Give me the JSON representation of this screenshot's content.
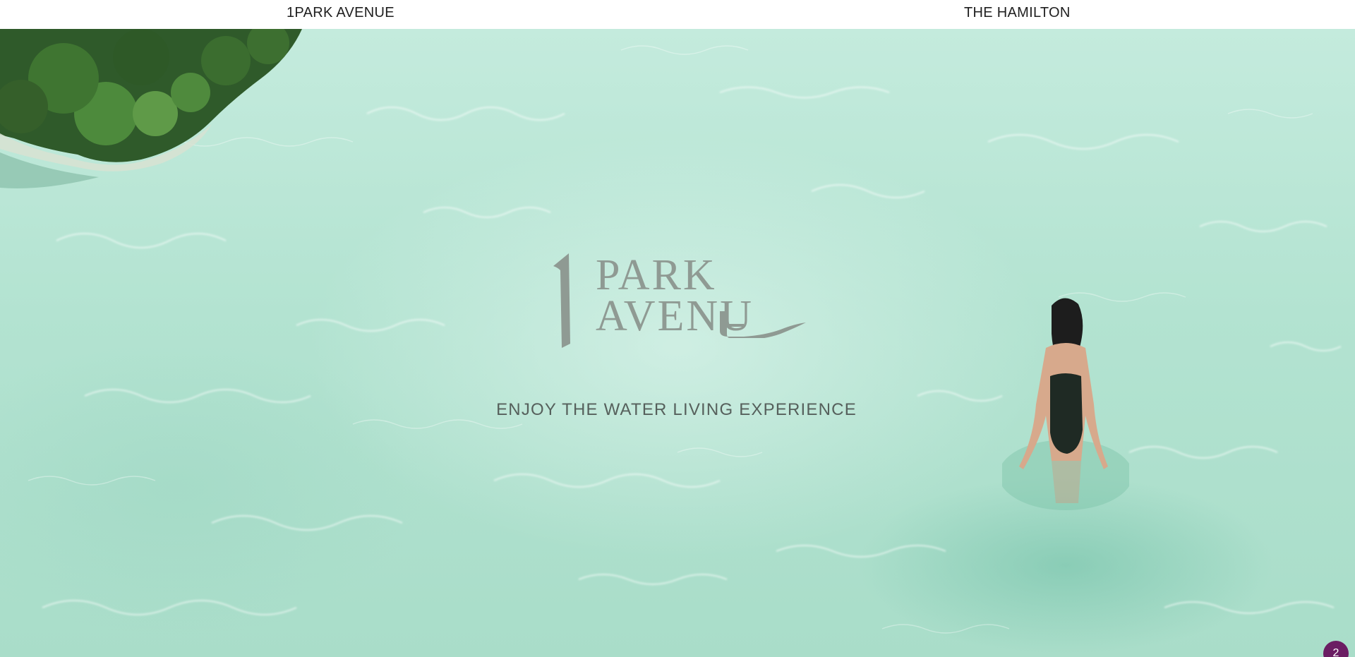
{
  "nav": {
    "items": [
      {
        "label": "1PARK AVENUE"
      },
      {
        "label": "THE HAMILTON"
      }
    ]
  },
  "hero": {
    "logo": {
      "numeral": "1",
      "line1": "PARK",
      "line2": "AVENU"
    },
    "tagline": "ENJOY THE WATER LIVING EXPERIENCE"
  },
  "badge": {
    "count": "2",
    "color": "#6b1d63"
  },
  "colors": {
    "water": "#b3e3d1",
    "logo": "#8f9a93",
    "tagline": "#56605c"
  }
}
